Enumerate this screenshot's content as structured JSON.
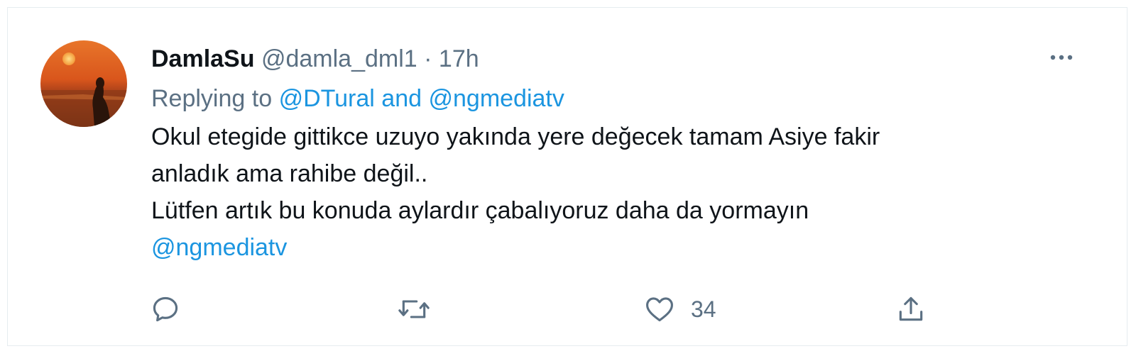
{
  "tweet": {
    "display_name": "DamlaSu",
    "handle": "@damla_dml1",
    "separator": "·",
    "time": "17h",
    "replying_prefix": "Replying to",
    "replying_user1": "@DTural",
    "replying_and": "and",
    "replying_user2": "@ngmediatv",
    "body_lines": [
      "Okul etegide gittikce uzuyo yakında yere değecek tamam Asiye fakir",
      "anladık ama rahibe değil..",
      "Lütfen artık bu konuda aylardır çabalıyoruz daha da yormayın"
    ],
    "body_mention": "@ngmediatv",
    "like_count": "34"
  },
  "icons": {
    "more": "more-horizontal-icon",
    "reply": "reply-bubble-icon",
    "retweet": "retweet-icon",
    "like": "heart-icon",
    "share": "share-upload-icon"
  },
  "colors": {
    "accent": "#1b95e0",
    "secondary_text": "#5b7083",
    "primary_text": "#0f1419"
  }
}
